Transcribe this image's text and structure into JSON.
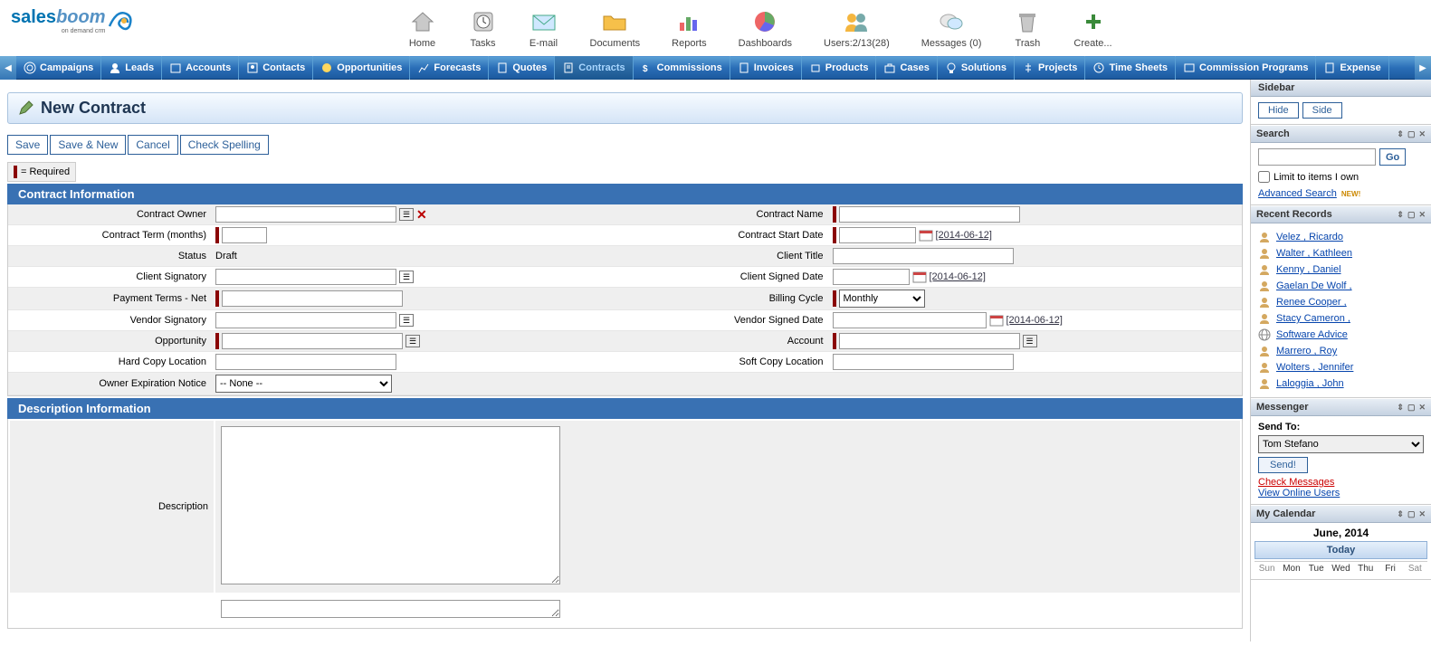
{
  "logo": {
    "brand_a": "sales",
    "brand_b": "boom",
    "sub": "on demand crm"
  },
  "toolbar": [
    {
      "label": "Home",
      "icon": "home"
    },
    {
      "label": "Tasks",
      "icon": "clock"
    },
    {
      "label": "E-mail",
      "icon": "mail"
    },
    {
      "label": "Documents",
      "icon": "folder"
    },
    {
      "label": "Reports",
      "icon": "chart"
    },
    {
      "label": "Dashboards",
      "icon": "pie"
    },
    {
      "label": "Users:2/13(28)",
      "icon": "users"
    },
    {
      "label": "Messages (0)",
      "icon": "msg"
    },
    {
      "label": "Trash",
      "icon": "trash"
    },
    {
      "label": "Create...",
      "icon": "plus"
    }
  ],
  "nav": [
    "Campaigns",
    "Leads",
    "Accounts",
    "Contacts",
    "Opportunities",
    "Forecasts",
    "Quotes",
    "Contracts",
    "Commissions",
    "Invoices",
    "Products",
    "Cases",
    "Solutions",
    "Projects",
    "Time Sheets",
    "Commission Programs",
    "Expense"
  ],
  "nav_active": "Contracts",
  "page_title": "New Contract",
  "actions": {
    "save": "Save",
    "save_new": "Save & New",
    "cancel": "Cancel",
    "spell": "Check Spelling"
  },
  "required_note": "= Required",
  "sections": {
    "contract_info": "Contract Information",
    "description_info": "Description Information"
  },
  "fields": {
    "contract_owner": "Contract Owner",
    "contract_name": "Contract Name",
    "contract_term": "Contract Term (months)",
    "contract_start": "Contract Start Date",
    "status": "Status",
    "client_title": "Client Title",
    "client_signatory": "Client Signatory",
    "client_signed_date": "Client Signed Date",
    "payment_terms": "Payment Terms - Net",
    "billing_cycle": "Billing Cycle",
    "vendor_signatory": "Vendor Signatory",
    "vendor_signed_date": "Vendor Signed Date",
    "opportunity": "Opportunity",
    "account": "Account",
    "hard_copy": "Hard Copy Location",
    "soft_copy": "Soft Copy Location",
    "owner_expiration": "Owner Expiration Notice",
    "description": "Description"
  },
  "values": {
    "status": "Draft",
    "billing_cycle": "Monthly",
    "owner_expiration": "-- None --",
    "date_today": "[2014-06-12]"
  },
  "sidebar": {
    "title": "Sidebar",
    "hide": "Hide",
    "side": "Side",
    "search": {
      "title": "Search",
      "go": "Go",
      "limit": "Limit to items I own",
      "advanced": "Advanced Search",
      "new": "NEW!"
    },
    "recent": {
      "title": "Recent Records",
      "items": [
        {
          "text": "Velez , Ricardo",
          "type": "person"
        },
        {
          "text": "Walter , Kathleen",
          "type": "person"
        },
        {
          "text": "Kenny , Daniel",
          "type": "person"
        },
        {
          "text": "Gaelan De Wolf ,",
          "type": "person"
        },
        {
          "text": "Renee Cooper ,",
          "type": "person"
        },
        {
          "text": "Stacy Cameron ,",
          "type": "person"
        },
        {
          "text": "Software Advice",
          "type": "account"
        },
        {
          "text": "Marrero , Roy",
          "type": "person"
        },
        {
          "text": "Wolters , Jennifer",
          "type": "person"
        },
        {
          "text": "Laloggia , John",
          "type": "person"
        }
      ]
    },
    "messenger": {
      "title": "Messenger",
      "send_to": "Send To:",
      "recipient": "Tom Stefano",
      "send": "Send!",
      "check": "Check Messages",
      "online": "View Online Users"
    },
    "calendar": {
      "title": "My Calendar",
      "month": "June, 2014",
      "today": "Today",
      "dow": [
        "Sun",
        "Mon",
        "Tue",
        "Wed",
        "Thu",
        "Fri",
        "Sat"
      ]
    }
  }
}
